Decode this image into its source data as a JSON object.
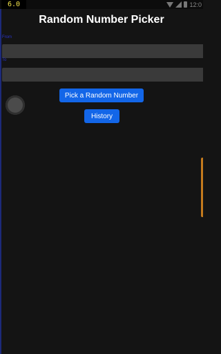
{
  "status_bar": {
    "fps": "6.0",
    "time": "12:0",
    "icons": [
      "wifi-icon",
      "signal-icon",
      "battery-icon"
    ]
  },
  "app": {
    "title": "Random Number Picker"
  },
  "form": {
    "from_label": "From",
    "from_value": "",
    "to_label": "To",
    "to_value": ""
  },
  "buttons": {
    "pick": "Pick a Random Number",
    "history": "History"
  },
  "colors": {
    "background": "#141414",
    "accent": "#1366e8",
    "label": "#2a33c9",
    "field": "#3a3a3a"
  }
}
